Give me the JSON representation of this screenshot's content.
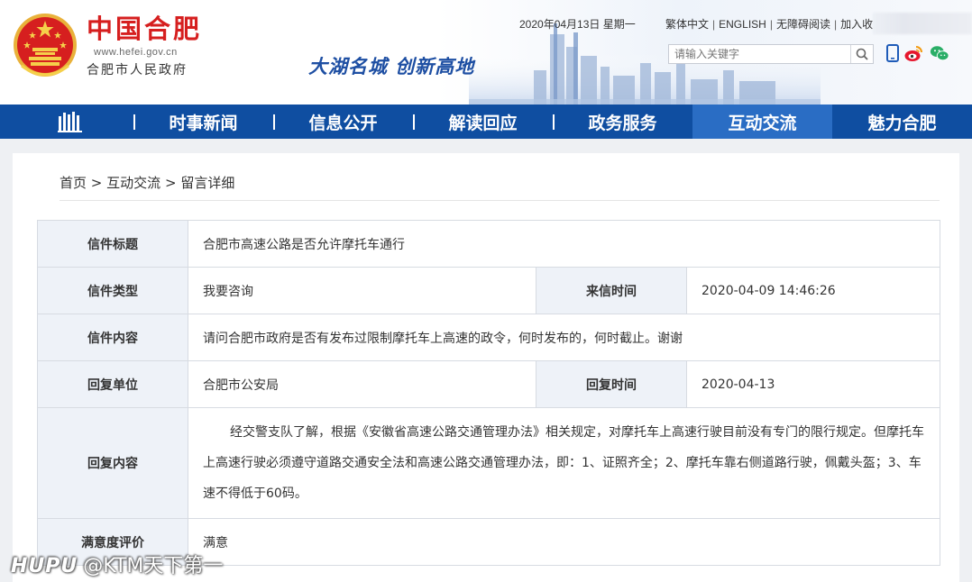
{
  "header": {
    "site_name": "中国合肥",
    "site_url": "www.hefei.gov.cn",
    "site_sub": "合肥市人民政府",
    "slogan": "大湖名城  创新高地",
    "date_text": "2020年04月13日 星期一",
    "links": [
      "繁体中文",
      "ENGLISH",
      "无障碍阅读",
      "加入收"
    ],
    "search_placeholder": "请输入关键字",
    "icons": [
      "mobile-icon",
      "weibo-icon",
      "wechat-icon",
      "search-icon"
    ],
    "emblem_color": "#d61f1f"
  },
  "nav": {
    "items": [
      "时事新闻",
      "信息公开",
      "解读回应",
      "政务服务",
      "互动交流",
      "魅力合肥"
    ],
    "active_index": 4,
    "bg_color": "#0f4ea1",
    "active_color": "#2a6dc4"
  },
  "breadcrumb": {
    "home": "首页",
    "sep": ">",
    "section": "互动交流",
    "page": "留言详细"
  },
  "detail": {
    "title_label": "信件标题",
    "title_value": "合肥市高速公路是否允许摩托车通行",
    "type_label": "信件类型",
    "type_value": "我要咨询",
    "time_label": "来信时间",
    "time_value": "2020-04-09 14:46:26",
    "content_label": "信件内容",
    "content_value": "请问合肥市政府是否有发布过限制摩托车上高速的政令，何时发布的，何时截止。谢谢",
    "reply_unit_label": "回复单位",
    "reply_unit_value": "合肥市公安局",
    "reply_time_label": "回复时间",
    "reply_time_value": "2020-04-13",
    "reply_content_label": "回复内容",
    "reply_content_value": "经交警支队了解，根据《安徽省高速公路交通管理办法》相关规定，对摩托车上高速行驶目前没有专门的限行规定。但摩托车上高速行驶必须遵守道路交通安全法和高速公路交通管理办法，即：1、证照齐全；2、摩托车靠右侧道路行驶，佩戴头盔；3、车速不得低于60码。",
    "satisfaction_label": "满意度评价",
    "satisfaction_value": "满意"
  },
  "watermark": {
    "brand": "HUPU",
    "user": "@KTM天下第一"
  }
}
